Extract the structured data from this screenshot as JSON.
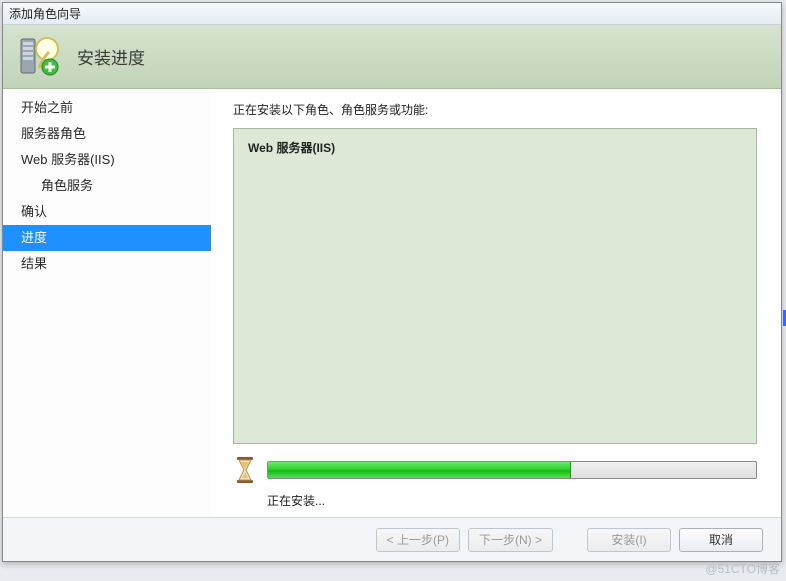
{
  "window": {
    "title": "添加角色向导"
  },
  "header": {
    "title": "安装进度"
  },
  "sidebar": {
    "items": [
      {
        "label": "开始之前",
        "sub": false,
        "selected": false
      },
      {
        "label": "服务器角色",
        "sub": false,
        "selected": false
      },
      {
        "label": "Web 服务器(IIS)",
        "sub": false,
        "selected": false
      },
      {
        "label": "角色服务",
        "sub": true,
        "selected": false
      },
      {
        "label": "确认",
        "sub": false,
        "selected": false
      },
      {
        "label": "进度",
        "sub": false,
        "selected": true
      },
      {
        "label": "结果",
        "sub": false,
        "selected": false
      }
    ]
  },
  "main": {
    "description": "正在安装以下角色、角色服务或功能:",
    "panel_heading": "Web 服务器(IIS)",
    "progress_percent": 62,
    "status": "正在安装..."
  },
  "footer": {
    "prev": "< 上一步(P)",
    "next": "下一步(N) >",
    "install": "安装(I)",
    "cancel": "取消"
  },
  "watermark": "@51CTO博客"
}
